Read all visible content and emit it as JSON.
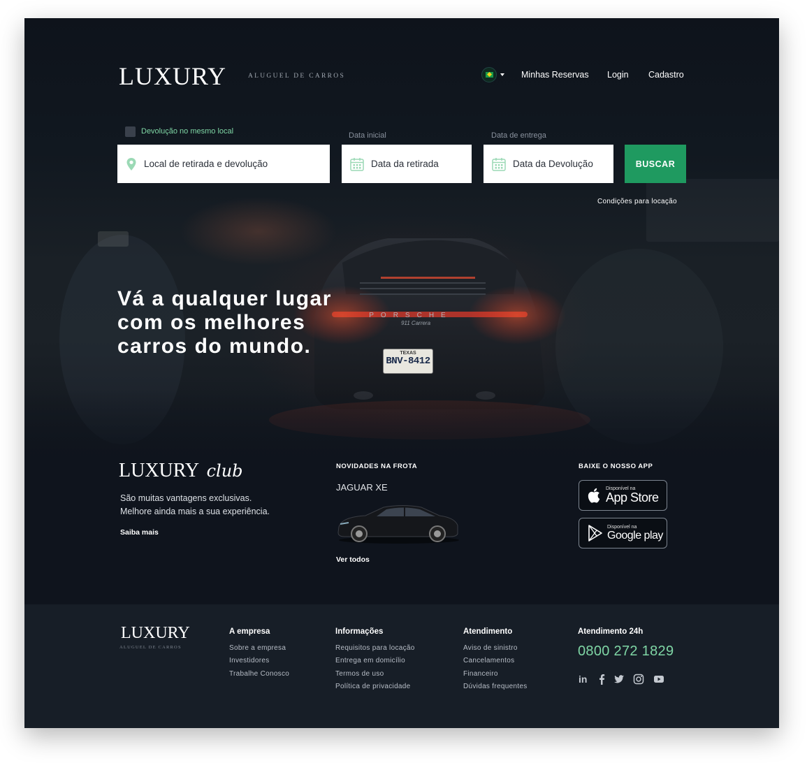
{
  "header": {
    "logo": "LUXURY",
    "tagline": "ALUGUEL DE CARROS",
    "nav": [
      "Minhas Reservas",
      "Login",
      "Cadastro"
    ]
  },
  "search": {
    "checkbox_label": "Devolução no mesmo local",
    "location_placeholder": "Local de retirada e devolução",
    "start_label": "Data inicial",
    "start_placeholder": "Data da retirada",
    "end_label": "Data de entrega",
    "end_placeholder": "Data da Devolução",
    "button": "BUSCAR",
    "conditions_link": "Condições para locação"
  },
  "hero": {
    "headline_1": "Vá a qualquer lugar",
    "headline_2": "com os melhores",
    "headline_3": "carros do mundo.",
    "plate_state": "TEXAS",
    "plate_number": "BNV-8412",
    "car_brand": "PORSCHE",
    "car_model": "911 Carrera"
  },
  "club": {
    "logo": "LUXURY",
    "logo_script": "club",
    "line_1": "São muitas vantagens exclusivas.",
    "line_2": "Melhore ainda mais a sua experiência.",
    "link": "Saiba mais"
  },
  "fleet": {
    "title": "NOVIDADES NA FROTA",
    "car_name": "JAGUAR XE",
    "link": "Ver todos"
  },
  "app": {
    "title": "BAIXE O NOSSO APP",
    "appstore_small": "Disponível na",
    "appstore_big": "App Store",
    "gplay_small": "Disponível na",
    "gplay_big": "Google play"
  },
  "footer": {
    "logo": "LUXURY",
    "tagline": "ALUGUEL DE CARROS",
    "col1": {
      "title": "A empresa",
      "links": [
        "Sobre a empresa",
        "Investidores",
        "Trabalhe Conosco"
      ]
    },
    "col2": {
      "title": "Informações",
      "links": [
        "Requisitos para locação",
        "Entrega em domicílio",
        "Termos de uso",
        "Política de privacidade"
      ]
    },
    "col3": {
      "title": "Atendimento",
      "links": [
        "Aviso de sinistro",
        "Cancelamentos",
        "Financeiro",
        "Dúvidas frequentes"
      ]
    },
    "support": {
      "title": "Atendimento 24h",
      "phone": "0800 272 1829"
    },
    "social": [
      "linkedin-icon",
      "facebook-icon",
      "twitter-icon",
      "instagram-icon",
      "youtube-icon"
    ]
  },
  "colors": {
    "accent": "#1f9a60",
    "phone": "#7fd6a5",
    "background": "#0f141d",
    "footer": "#171e27"
  }
}
